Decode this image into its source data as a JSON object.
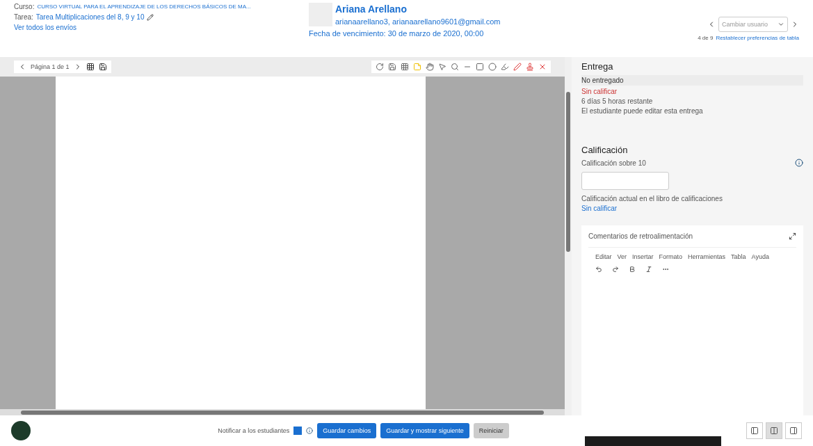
{
  "header": {
    "course_label": "Curso:",
    "course": "CURSO VIRTUAL PARA EL APRENDIZAJE DE LOS DERECHOS BÁSICOS DE MA...",
    "task_label": "Tarea:",
    "task": "Tarea Multiplicaciones del 8, 9 y 10",
    "view_all": "Ver todos los envíos",
    "user_name": "Ariana Arellano",
    "user_email": "arianaarellano3, arianaarellano9601@gmail.com",
    "due": "Fecha de vencimiento: 30 de marzo de 2020, 00:00",
    "change_user": {
      "placeholder": "Cambiar usuario"
    },
    "position": "4 de 9",
    "reset_prefs": "Restablecer preferencias de tabla"
  },
  "pdf_toolbar": {
    "page": "Página 1 de 1"
  },
  "submission": {
    "title": "Entrega",
    "status": "No entregado",
    "grading": "Sin calificar",
    "time_left": "6 días 5 horas restante",
    "editable_note": "El estudiante puede editar esta entrega"
  },
  "grade": {
    "title": "Calificación",
    "label": "Calificación sobre 10",
    "gradebook_label": "Calificación actual en el libro de calificaciones",
    "gradebook_value": "Sin calificar"
  },
  "feedback": {
    "title": "Comentarios de retroalimentación",
    "menu": [
      "Editar",
      "Ver",
      "Insertar",
      "Formato",
      "Herramientas",
      "Tabla",
      "Ayuda"
    ]
  },
  "footer": {
    "notify": {
      "label": "Notificar a los estudiantes",
      "checked": true
    },
    "buttons": [
      {
        "label": "Guardar cambios",
        "kind": "primary"
      },
      {
        "label": "Guardar y mostrar siguiente",
        "kind": "primary"
      },
      {
        "label": "Reiniciar",
        "kind": "secondary"
      }
    ],
    "layout_modes": [
      {
        "selected": false
      },
      {
        "selected": true
      },
      {
        "selected": false
      }
    ]
  }
}
